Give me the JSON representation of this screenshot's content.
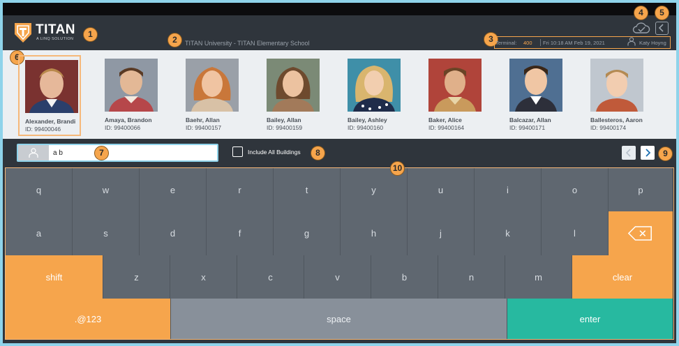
{
  "app": {
    "logo_title": "TITAN",
    "logo_subtitle": "A LINQ SOLUTION",
    "school": "TITAN University - TITAN Elementary School"
  },
  "status": {
    "terminal_label": "Terminal:",
    "terminal_number": "400",
    "datetime": "Fri 10:18 AM Feb 19, 2021",
    "user": "Katy Hoyng"
  },
  "callouts": [
    "1",
    "2",
    "3",
    "4",
    "5",
    "6",
    "7",
    "8",
    "9",
    "10"
  ],
  "students": [
    {
      "name": "Alexander, Brandi",
      "id": "ID: 99400046",
      "selected": true
    },
    {
      "name": "Amaya, Brandon",
      "id": "ID: 99400066"
    },
    {
      "name": "Baehr, Allan",
      "id": "ID: 99400157"
    },
    {
      "name": "Bailey, Allan",
      "id": "ID: 99400159"
    },
    {
      "name": "Bailey, Ashley",
      "id": "ID: 99400160"
    },
    {
      "name": "Baker, Alice",
      "id": "ID: 99400164"
    },
    {
      "name": "Balcazar, Allan",
      "id": "ID: 99400171"
    },
    {
      "name": "Ballesteros, Aaron",
      "id": "ID: 99400174"
    }
  ],
  "search": {
    "value": "a b",
    "include_all_label": "Include All Buildings"
  },
  "keyboard": {
    "row1": [
      "q",
      "w",
      "e",
      "r",
      "t",
      "y",
      "u",
      "i",
      "o",
      "p"
    ],
    "row2": [
      "a",
      "s",
      "d",
      "f",
      "g",
      "h",
      "j",
      "k",
      "l"
    ],
    "row3": [
      "z",
      "x",
      "c",
      "v",
      "b",
      "n",
      "m"
    ],
    "shift": "shift",
    "clear": "clear",
    "symbols": ".@123",
    "space": "space",
    "enter": "enter"
  },
  "icons": {
    "logo": "titan-shield-icon",
    "sync": "cloud-check-icon",
    "back": "chevron-left-icon",
    "user": "user-icon",
    "search": "person-icon",
    "prev": "chevron-left-icon",
    "next": "chevron-right-icon",
    "backspace": "backspace-icon"
  },
  "colors": {
    "accent": "#f6a54c",
    "teal": "#27b9a0",
    "header_bg": "#2f353c",
    "key_bg": "#5f6770",
    "highlight": "#8fd3ea"
  }
}
